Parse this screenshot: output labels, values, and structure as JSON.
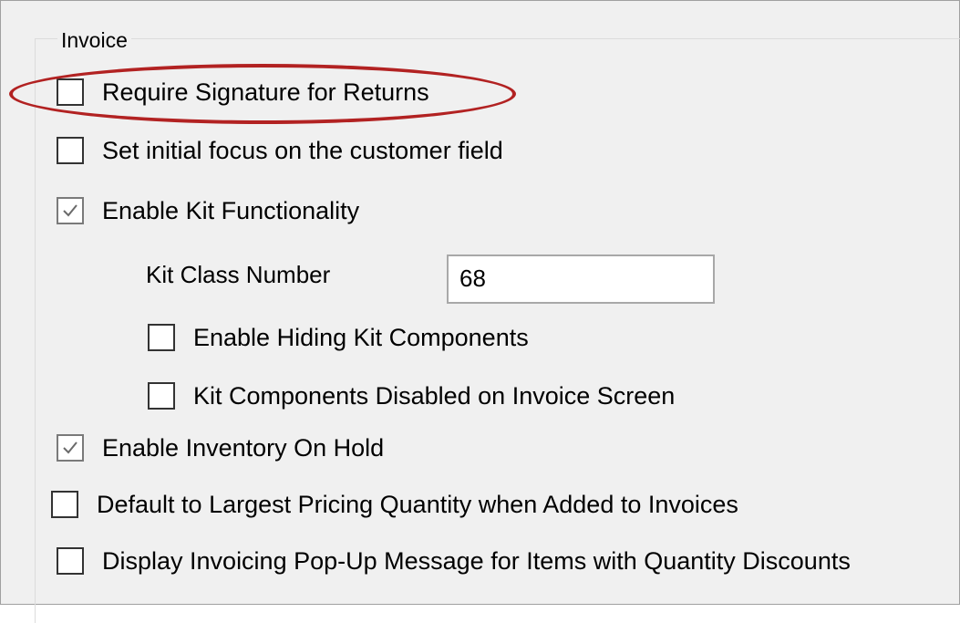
{
  "group": {
    "title": "Invoice"
  },
  "options": {
    "require_signature": {
      "label": "Require Signature for Returns",
      "checked": false
    },
    "initial_focus": {
      "label": "Set initial focus on the customer field",
      "checked": false
    },
    "enable_kit": {
      "label": "Enable Kit Functionality",
      "checked": true
    },
    "kit_class": {
      "label": "Kit Class Number",
      "value": "68"
    },
    "hide_kit_components": {
      "label": "Enable Hiding Kit Components",
      "checked": false
    },
    "kit_components_disabled": {
      "label": "Kit Components Disabled on Invoice Screen",
      "checked": false
    },
    "inventory_on_hold": {
      "label": "Enable Inventory On Hold",
      "checked": true
    },
    "largest_pricing_qty": {
      "label": "Default to Largest Pricing Quantity when Added to Invoices",
      "checked": false
    },
    "popup_qty_discounts": {
      "label": "Display Invoicing Pop-Up Message for Items with Quantity Discounts",
      "checked": false
    }
  },
  "colors": {
    "highlight": "#b22222",
    "panel": "#f0f0f0",
    "checkmark": "#6a6a6a"
  }
}
